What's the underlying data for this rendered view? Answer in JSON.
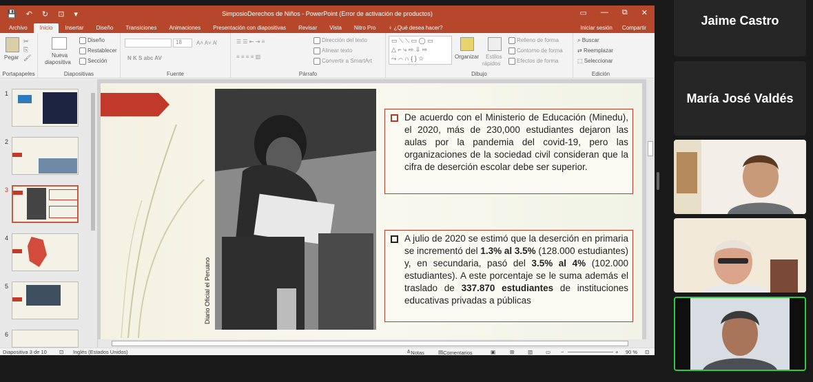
{
  "window": {
    "title": "SimposioDerechos de Niños - PowerPoint (Error de activación de productos)",
    "qat": [
      "💾",
      "↶",
      "↻",
      "⊡",
      "▾"
    ],
    "controls": [
      "▭",
      "—",
      "⧉",
      "✕"
    ]
  },
  "menu": {
    "tabs": [
      "Archivo",
      "Inicio",
      "Insertar",
      "Diseño",
      "Transiciones",
      "Animaciones",
      "Presentación con diapositivas",
      "Revisar",
      "Vista",
      "Nitro Pro",
      "♀ ¿Qué desea hacer?"
    ],
    "active": "Inicio",
    "signin": "Iniciar sesión",
    "share": "Compartir"
  },
  "ribbon": {
    "clipboard": {
      "paste": "Pegar",
      "label": "Portapapeles"
    },
    "slides": {
      "new_slide_1": "Nueva",
      "new_slide_2": "diapositiva",
      "design": "Diseño",
      "reset": "Restablecer",
      "section": "Sección",
      "label": "Diapositivas"
    },
    "font": {
      "size": "18",
      "styles": "N  K  S  abc  AV",
      "label": "Fuente"
    },
    "paragraph": {
      "direction": "Dirección del texto",
      "align": "Alinear texto",
      "smartart": "Convertir a SmartArt",
      "label": "Párrafo"
    },
    "drawing": {
      "organize": "Organizar",
      "quick_styles_1": "Estilos",
      "quick_styles_2": "rápidos",
      "fill": "Relleno de forma",
      "outline": "Contorno de forma",
      "effects": "Efectos de forma",
      "label": "Dibujo"
    },
    "editing": {
      "find": "Buscar",
      "replace": "Reemplazar",
      "select": "Seleccionar",
      "label": "Edición"
    }
  },
  "thumbnails": [
    {
      "num": "1",
      "active": false
    },
    {
      "num": "2",
      "active": false
    },
    {
      "num": "3",
      "active": true
    },
    {
      "num": "4",
      "active": false
    },
    {
      "num": "5",
      "active": false
    },
    {
      "num": "6",
      "active": false
    }
  ],
  "slide": {
    "photo_credit": "Diario Oficial el Peruano",
    "box1": "De acuerdo con el Ministerio de Educación (Minedu), el 2020, más de 230,000 estudiantes dejaron las aulas por la pandemia del covid-19, pero las organizaciones de la sociedad civil consideran que la cifra de deserción escolar debe ser superior.",
    "box2": {
      "p1": "A julio de 2020 se estimó que la deserción en primaria se incrementó del ",
      "b1": "1.3% al 3.5%",
      "p2": " (128.000 estudiantes) y, en secundaria, pasó del ",
      "b2": "3.5% al 4%",
      "p3": " (102.000 estudiantes). A este porcentaje se le suma además el traslado de ",
      "b3": "337.870 estudiantes",
      "p4": " de instituciones educativas privadas a públicas"
    }
  },
  "status": {
    "slide_info": "Diapositiva 3 de 10",
    "language": "Inglés (Estados Unidos)",
    "notes": "Notas",
    "comments": "Comentarios",
    "zoom": "90 %"
  },
  "participants": [
    {
      "name": "Jaime Castro"
    },
    {
      "name": "María José Valdés"
    }
  ],
  "colors": {
    "accent": "#b7472a",
    "speaking_border": "#2ecc40"
  }
}
